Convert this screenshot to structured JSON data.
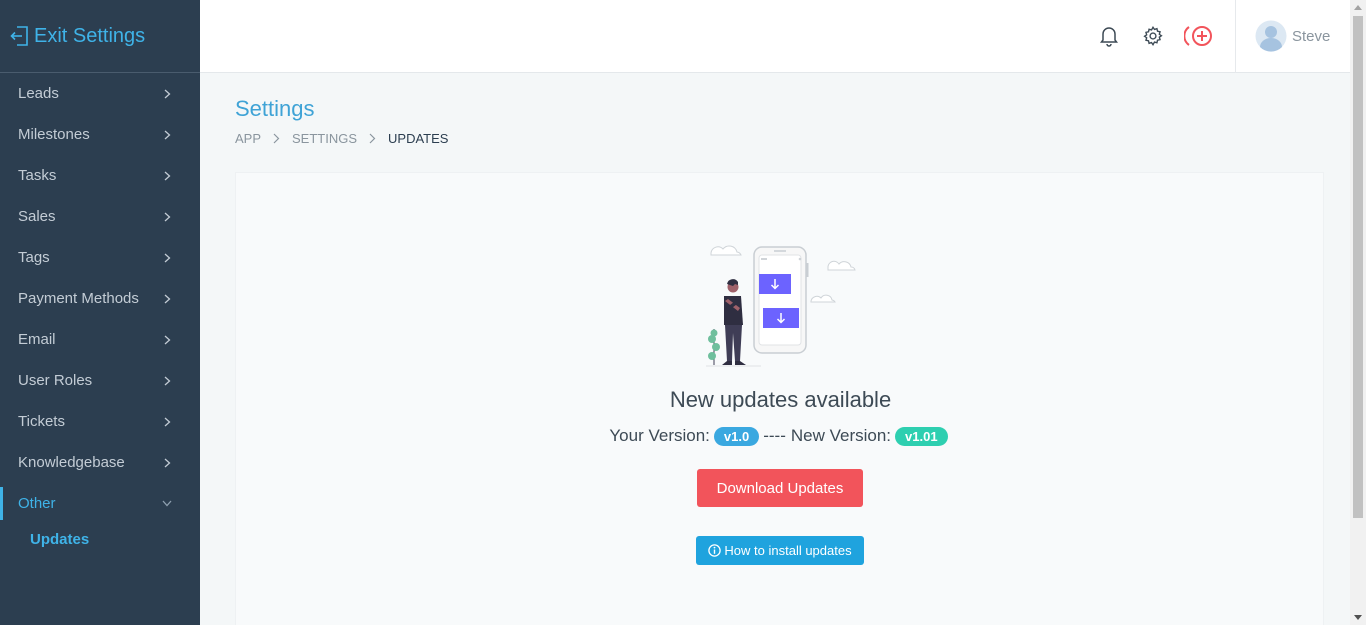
{
  "sidebar": {
    "exit_label": "Exit Settings",
    "items": [
      {
        "label": "Leads"
      },
      {
        "label": "Milestones"
      },
      {
        "label": "Tasks"
      },
      {
        "label": "Sales"
      },
      {
        "label": "Tags"
      },
      {
        "label": "Payment Methods"
      },
      {
        "label": "Email"
      },
      {
        "label": "User Roles"
      },
      {
        "label": "Tickets"
      },
      {
        "label": "Knowledgebase"
      },
      {
        "label": "Other",
        "active": true
      }
    ],
    "sub_items": [
      {
        "label": "Updates",
        "active": true
      }
    ]
  },
  "header": {
    "icons": [
      "bell-icon",
      "gear-icon",
      "add-circle-icon"
    ],
    "user": {
      "name": "Steve",
      "avatar": "avatar-icon"
    }
  },
  "page": {
    "title": "Settings",
    "breadcrumb": [
      "APP",
      "SETTINGS",
      "UPDATES"
    ]
  },
  "updates": {
    "heading": "New updates available",
    "your_version_label": "Your Version:",
    "your_version": "v1.0",
    "separator": "----",
    "new_version_label": "New Version:",
    "new_version": "v1.01",
    "download_label": "Download Updates",
    "howto_label": "How to install updates"
  },
  "colors": {
    "sidebar_bg": "#2c3e50",
    "accent": "#3fb3e8",
    "danger": "#f2545b",
    "teal": "#2ecfb0",
    "info": "#1fa3de"
  }
}
